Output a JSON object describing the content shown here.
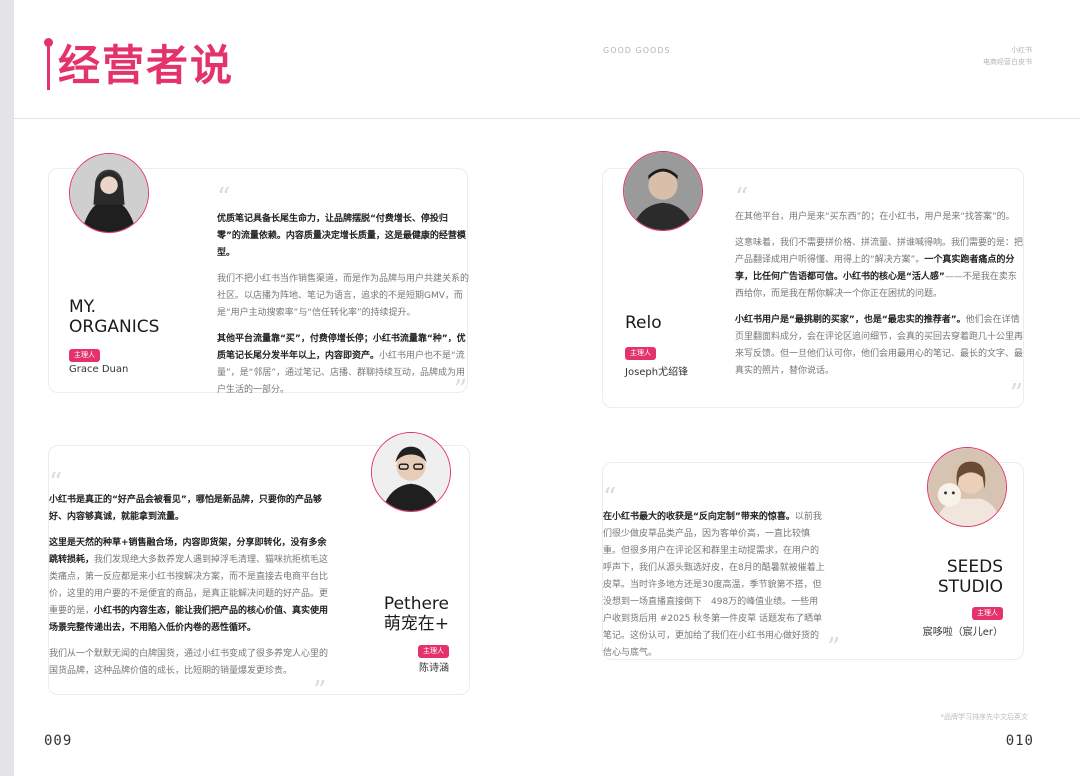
{
  "header": {
    "title": "经营者说",
    "brand_mid": "GOOD GOODS",
    "brand_right_line1": "小红书",
    "brand_right_line2": "电商经营白皮书"
  },
  "cards": [
    {
      "brand_lines": [
        "MY.",
        "ORGANICS"
      ],
      "tag": "主理人",
      "person": "Grace Duan",
      "paragraphs": [
        {
          "bold": "优质笔记具备长尾生命力，让品牌摆脱“付费增长、停投归零”的流量依赖。内容质量决定增长质量，这是最健康的经营模型。",
          "rest": ""
        },
        {
          "bold": "",
          "rest": "我们不把小红书当作销售渠道，而是作为品牌与用户共建关系的社区。以店播为阵地、笔记为语言，追求的不是短期GMV，而是“用户主动搜索率”与“信任转化率”的持续提升。"
        },
        {
          "bold": "其他平台流量靠“买”，付费停增长停；小红书流量靠“种”，优质笔记长尾分发半年以上，内容即资产。",
          "rest": "小红书用户也不是“流量”，是“邻居”，通过笔记、店播、群聊持续互动，品牌成为用户生活的一部分。"
        }
      ]
    },
    {
      "brand_lines": [
        "Relo"
      ],
      "tag": "主理人",
      "person": "Joseph尤绍锋",
      "paragraphs": [
        {
          "bold": "",
          "rest": "在其他平台，用户是来“买东西”的；在小红书，用户是来“找答案”的。"
        },
        {
          "bold": "",
          "rest": "这意味着，我们不需要拼价格、拼流量、拼谁喊得响。我们需要的是：把产品翻译成用户听得懂、用得上的“解决方案”。",
          "bold2": "一个真实跑者痛点的分享，比任何广告语都可信。小红书的核心是“活人感”",
          "rest2": "——不是我在卖东西给你，而是我在帮你解决一个你正在困扰的问题。"
        },
        {
          "bold": "小红书用户是“最挑剔的买家”，也是“最忠实的推荐者”。",
          "rest": "他们会在详情页里翻面料成分，会在评论区追问细节，会真的买回去穿着跑几十公里再来写反馈。但一旦他们认可你，他们会用最用心的笔记、最长的文字、最真实的照片，替你说话。"
        }
      ]
    },
    {
      "brand_lines": [
        "Pethere",
        "萌宠在+"
      ],
      "tag": "主理人",
      "person": "陈诗涵",
      "paragraphs": [
        {
          "bold": "小红书是真正的“好产品会被看见”，哪怕是新品牌，只要你的产品够好、内容够真诚，就能拿到流量。",
          "rest": ""
        },
        {
          "bold": "这里是天然的种草+销售融合场，内容即货架，分享即转化，没有多余跳转损耗，",
          "rest": "我们发现绝大多数养宠人遇到掉浮毛清理、猫咪抗拒梳毛这类痛点，第一反应都是来小红书搜解决方案，而不是直接去电商平台比价，这里的用户要的不是便宜的商品，是真正能解决问题的好产品。更重要的是，",
          "bold2": "小红书的内容生态，能让我们把产品的核心价值、真实使用场景完整传递出去，不用陷入低价内卷的恶性循环。",
          "rest2": ""
        },
        {
          "bold": "",
          "rest": "我们从一个默默无闻的白牌国货，通过小红书变成了很多养宠人心里的国货品牌，这种品牌价值的成长，比短期的销量爆发更珍贵。"
        }
      ]
    },
    {
      "brand_lines": [
        "SEEDS",
        "STUDIO"
      ],
      "tag": "主理人",
      "person": "宸哆啦（宸儿er）",
      "paragraphs": [
        {
          "bold": "在小红书最大的收获是“反向定制”带来的惊喜。",
          "rest": "以前我们很少做皮草品类产品，因为客单价高，一直比较慎重。但很多用户在评论区和群里主动提需求，在用户的呼声下，我们从源头甄选好皮，在8月的酷暑就被催着上皮草。当时许多地方还是30度高温，季节貌第不搭，但没想到一场直播直接倒下　498万的峰值业绩。一些用户收到货后用 #2025 秋冬第一件皮草 话题发布了晒单笔记。这份认可，更加给了我们在小红书用心做好货的信心与底气。"
        }
      ]
    }
  ],
  "footer": {
    "page_left": "009",
    "page_right": "010",
    "footnote": "*品牌学习排序先中文后英文"
  },
  "colors": {
    "accent": "#e4336b",
    "text": "#333333",
    "muted": "#777777"
  }
}
